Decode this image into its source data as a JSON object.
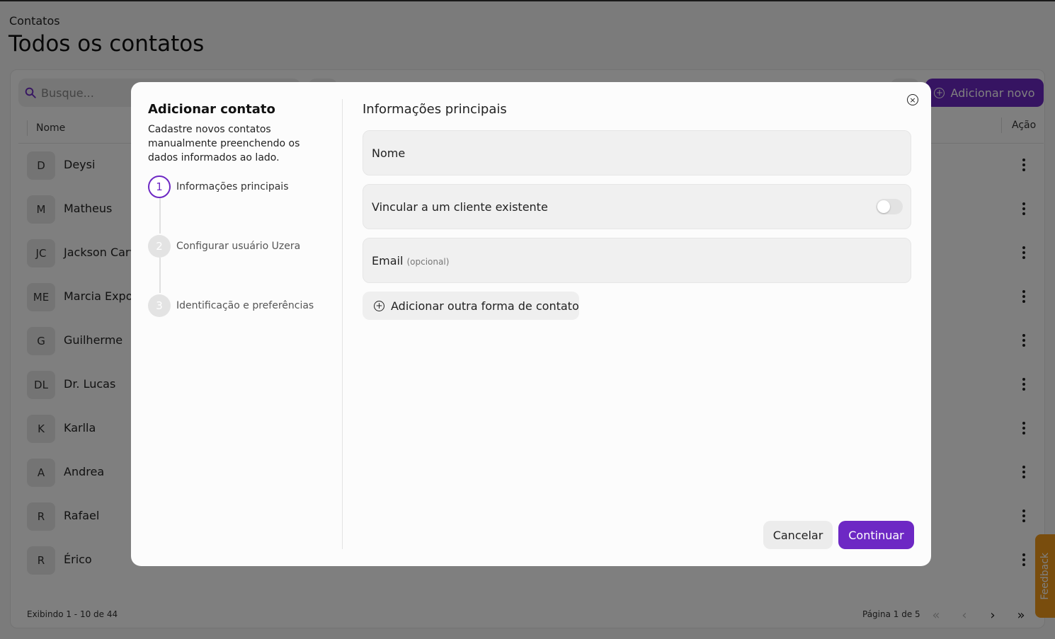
{
  "header": {
    "breadcrumb": "Contatos",
    "title": "Todos os contatos"
  },
  "toolbar": {
    "search_placeholder": "Busque...",
    "add_new_label": "Adicionar novo"
  },
  "table": {
    "columns": {
      "name": "Nome",
      "action": "Ação"
    },
    "rows": [
      {
        "initials": "D",
        "name": "Deysi"
      },
      {
        "initials": "M",
        "name": "Matheus"
      },
      {
        "initials": "JC",
        "name": "Jackson Carv"
      },
      {
        "initials": "ME",
        "name": "Marcia Expos"
      },
      {
        "initials": "G",
        "name": "Guilherme"
      },
      {
        "initials": "DL",
        "name": "Dr. Lucas"
      },
      {
        "initials": "K",
        "name": "Karlla"
      },
      {
        "initials": "A",
        "name": "Andrea"
      },
      {
        "initials": "R",
        "name": "Rafael"
      },
      {
        "initials": "R",
        "name": "Érico"
      }
    ]
  },
  "footer": {
    "showing": "Exibindo 1 - 10 de 44",
    "page": "Página 1 de 5"
  },
  "feedback_label": "Feedback",
  "modal": {
    "title": "Adicionar contato",
    "description": "Cadastre novos contatos manualmente preenchendo os dados informados ao lado.",
    "steps": [
      {
        "number": "1",
        "label": "Informações principais"
      },
      {
        "number": "2",
        "label": "Configurar usuário Uzera"
      },
      {
        "number": "3",
        "label": "Identificação e preferências"
      }
    ],
    "section_title": "Informações principais",
    "fields": {
      "name_placeholder": "Nome",
      "link_client_label": "Vincular a um cliente existente",
      "email_label": "Email",
      "email_optional": "(opcional)"
    },
    "add_contact_label": "Adicionar outra forma de contato",
    "cancel_label": "Cancelar",
    "continue_label": "Continuar"
  },
  "colors": {
    "accent": "#6d28c4",
    "feedback": "#f39a1a"
  }
}
